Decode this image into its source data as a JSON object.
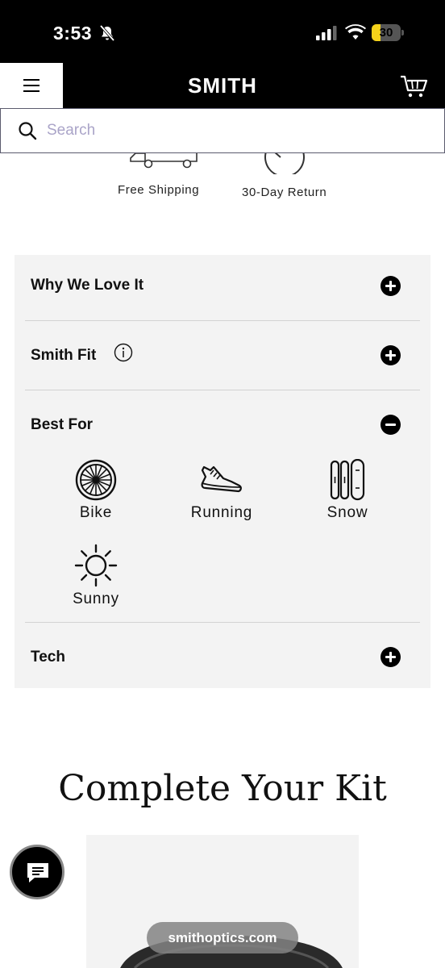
{
  "status_bar": {
    "time": "3:53",
    "battery": "30",
    "battery_fraction": 0.3
  },
  "header": {
    "logo": "SMITH"
  },
  "search": {
    "placeholder": "Search"
  },
  "perks": [
    {
      "label": "Free Shipping",
      "icon": "truck-icon"
    },
    {
      "label": "30-Day Return",
      "icon": "return-icon"
    }
  ],
  "accordion": {
    "why_we_love_it": "Why We Love It",
    "smith_fit": "Smith Fit",
    "best_for": "Best For",
    "tech": "Tech"
  },
  "best_for_items": [
    {
      "label": "Bike",
      "icon": "bike-wheel-icon"
    },
    {
      "label": "Running",
      "icon": "running-shoe-icon"
    },
    {
      "label": "Snow",
      "icon": "skis-snowboard-icon"
    },
    {
      "label": "Sunny",
      "icon": "sun-icon"
    }
  ],
  "kit": {
    "title": "Complete Your Kit"
  },
  "browser": {
    "url": "smithoptics.com"
  }
}
